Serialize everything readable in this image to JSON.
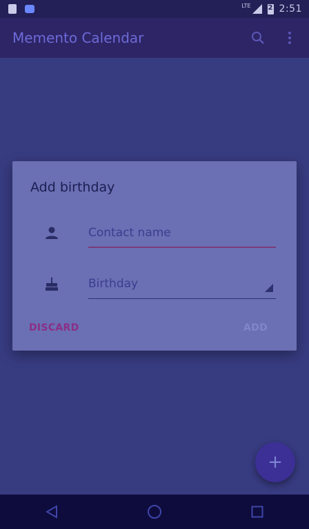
{
  "status_bar": {
    "network": "LTE",
    "battery_level": "2",
    "time": "2:51",
    "icons": [
      "sd-card-icon",
      "android-debug-icon",
      "signal-icon",
      "battery-icon"
    ]
  },
  "app_bar": {
    "title": "Memento Calendar",
    "actions": [
      "search-icon",
      "more-vert-icon"
    ]
  },
  "dialog": {
    "title": "Add birthday",
    "contact_field": {
      "placeholder": "Contact name",
      "icon": "person-icon"
    },
    "birthday_field": {
      "value": "Birthday",
      "icon": "cake-icon"
    },
    "discard_label": "DISCARD",
    "add_label": "ADD"
  },
  "fab": {
    "label": "+",
    "icon": "add-icon"
  },
  "nav_bar": {
    "buttons": [
      "back-icon",
      "home-icon",
      "recents-icon"
    ]
  },
  "colors": {
    "app_bar": "#2e2566",
    "status_bar": "#232057",
    "dialog": "#6b6fb3",
    "discard_accent": "#8a2f88",
    "nav_bar": "#0d0c3d"
  }
}
